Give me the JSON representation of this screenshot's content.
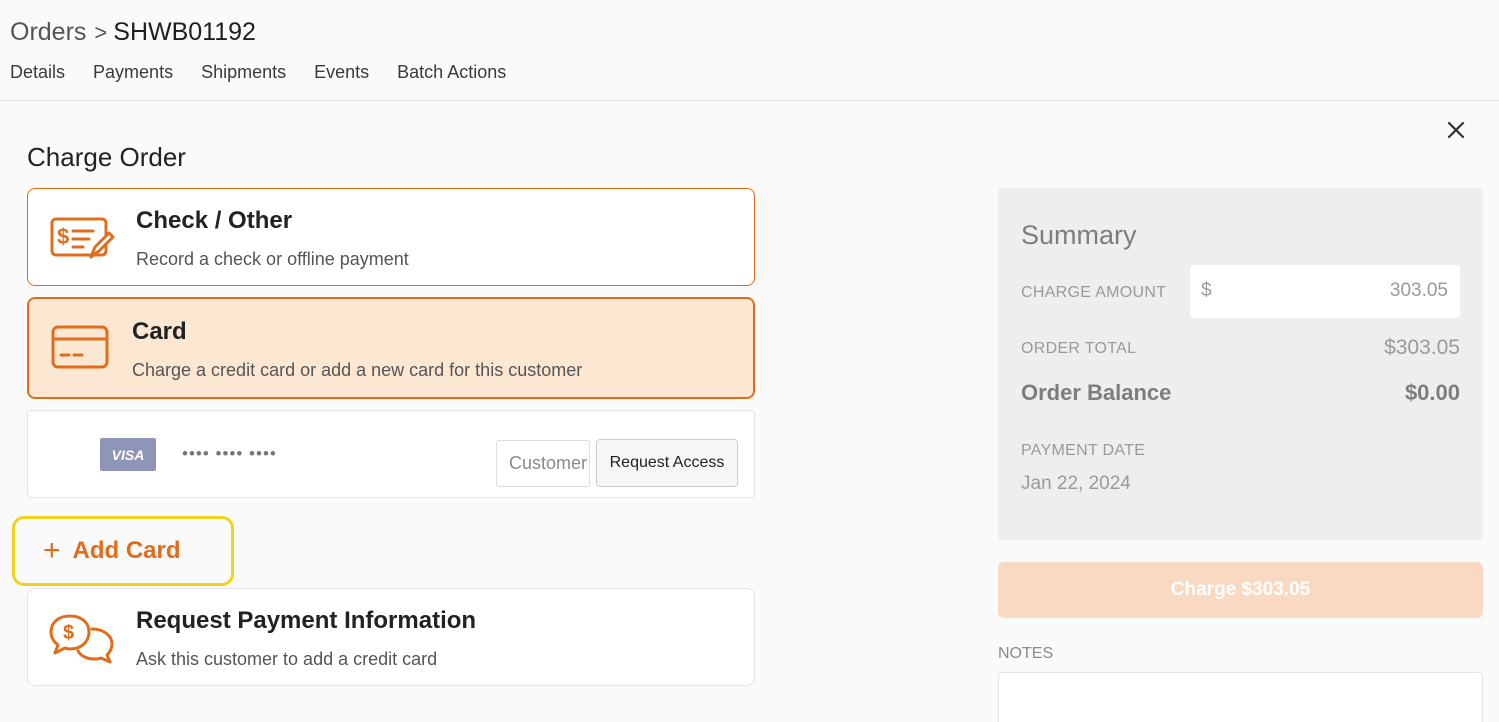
{
  "breadcrumb": {
    "parent": "Orders",
    "separator": ">",
    "current": "SHWB01192"
  },
  "tabs": [
    "Details",
    "Payments",
    "Shipments",
    "Events",
    "Batch Actions"
  ],
  "section_title": "Charge Order",
  "options": {
    "check": {
      "title": "Check / Other",
      "description": "Record a check or offline payment",
      "icon": "check-payment-icon"
    },
    "card": {
      "title": "Card",
      "description": "Charge a credit card or add a new card for this customer",
      "icon": "credit-card-icon"
    },
    "request": {
      "title": "Request Payment Information",
      "description": "Ask this customer to add a credit card",
      "icon": "chat-dollar-icon"
    }
  },
  "saved_card": {
    "brand": "VISA",
    "number_masked": "•••• •••• ••••",
    "cvc_placeholder": "Customer",
    "request_access_label": "Request Access"
  },
  "add_card": {
    "icon": "+",
    "label": "Add Card"
  },
  "summary": {
    "heading": "Summary",
    "charge_amount_label": "CHARGE AMOUNT",
    "currency_symbol": "$",
    "charge_amount_value": "303.05",
    "order_total_label": "ORDER TOTAL",
    "order_total_value": "$303.05",
    "order_balance_label": "Order Balance",
    "order_balance_value": "$0.00",
    "payment_date_label": "PAYMENT DATE",
    "payment_date_value": "Jan 22, 2024"
  },
  "charge_button_label": "Charge $303.05",
  "notes_label": "NOTES",
  "colors": {
    "accent": "#e06d1b",
    "selected_bg": "#fce7d2",
    "highlight": "#f2d21b",
    "button_disabled": "#fad9c3"
  }
}
